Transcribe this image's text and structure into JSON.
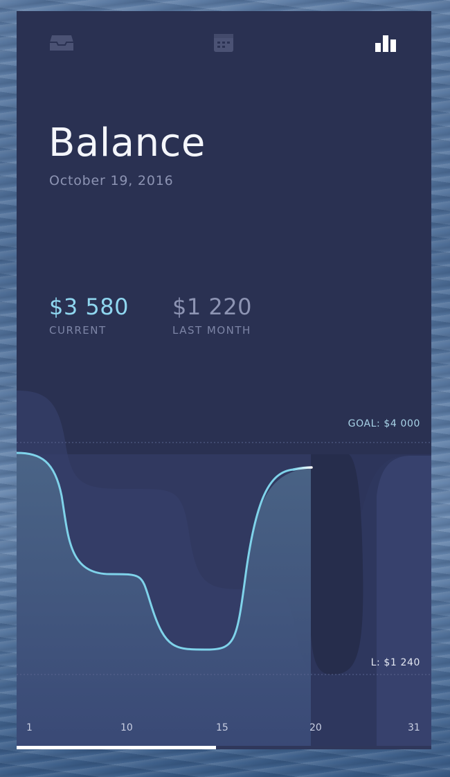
{
  "nav": {
    "inbox_icon": "inbox-icon",
    "calendar_icon": "calendar-icon",
    "chart_icon": "bar-chart-icon"
  },
  "header": {
    "title": "Balance",
    "date": "October 19, 2016"
  },
  "stats": {
    "current": {
      "amount": "$3 580",
      "label": "CURRENT",
      "color": "#8fd6ef"
    },
    "last_month": {
      "amount": "$1 220",
      "label": "LAST MONTH",
      "color": "#8d94b3"
    }
  },
  "chart": {
    "goal_label": "GOAL: $4 000",
    "low_label": "L: $1 240",
    "x_ticks": [
      "1",
      "10",
      "15",
      "20",
      "31"
    ],
    "line_color": "#7fd3ea"
  },
  "progress": {
    "value": 0.48
  }
}
